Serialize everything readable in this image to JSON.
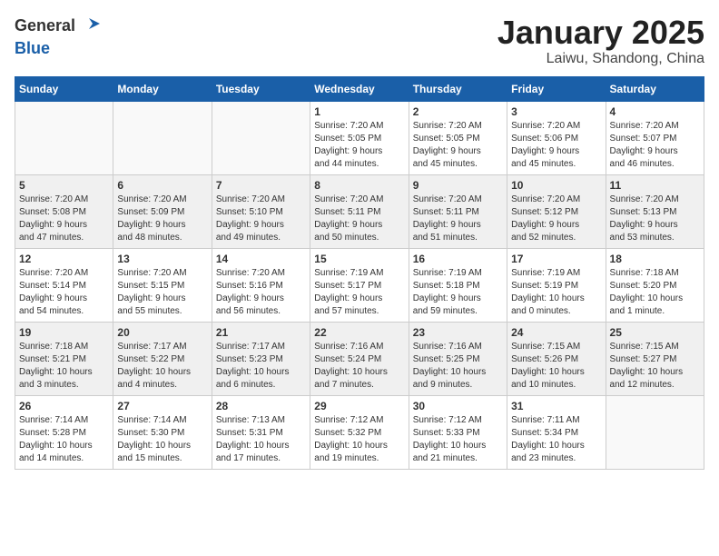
{
  "header": {
    "logo": {
      "general": "General",
      "blue": "Blue"
    },
    "title": "January 2025",
    "subtitle": "Laiwu, Shandong, China"
  },
  "weekdays": [
    "Sunday",
    "Monday",
    "Tuesday",
    "Wednesday",
    "Thursday",
    "Friday",
    "Saturday"
  ],
  "weeks": [
    {
      "shaded": false,
      "days": [
        {
          "num": "",
          "info": ""
        },
        {
          "num": "",
          "info": ""
        },
        {
          "num": "",
          "info": ""
        },
        {
          "num": "1",
          "info": "Sunrise: 7:20 AM\nSunset: 5:05 PM\nDaylight: 9 hours\nand 44 minutes."
        },
        {
          "num": "2",
          "info": "Sunrise: 7:20 AM\nSunset: 5:05 PM\nDaylight: 9 hours\nand 45 minutes."
        },
        {
          "num": "3",
          "info": "Sunrise: 7:20 AM\nSunset: 5:06 PM\nDaylight: 9 hours\nand 45 minutes."
        },
        {
          "num": "4",
          "info": "Sunrise: 7:20 AM\nSunset: 5:07 PM\nDaylight: 9 hours\nand 46 minutes."
        }
      ]
    },
    {
      "shaded": true,
      "days": [
        {
          "num": "5",
          "info": "Sunrise: 7:20 AM\nSunset: 5:08 PM\nDaylight: 9 hours\nand 47 minutes."
        },
        {
          "num": "6",
          "info": "Sunrise: 7:20 AM\nSunset: 5:09 PM\nDaylight: 9 hours\nand 48 minutes."
        },
        {
          "num": "7",
          "info": "Sunrise: 7:20 AM\nSunset: 5:10 PM\nDaylight: 9 hours\nand 49 minutes."
        },
        {
          "num": "8",
          "info": "Sunrise: 7:20 AM\nSunset: 5:11 PM\nDaylight: 9 hours\nand 50 minutes."
        },
        {
          "num": "9",
          "info": "Sunrise: 7:20 AM\nSunset: 5:11 PM\nDaylight: 9 hours\nand 51 minutes."
        },
        {
          "num": "10",
          "info": "Sunrise: 7:20 AM\nSunset: 5:12 PM\nDaylight: 9 hours\nand 52 minutes."
        },
        {
          "num": "11",
          "info": "Sunrise: 7:20 AM\nSunset: 5:13 PM\nDaylight: 9 hours\nand 53 minutes."
        }
      ]
    },
    {
      "shaded": false,
      "days": [
        {
          "num": "12",
          "info": "Sunrise: 7:20 AM\nSunset: 5:14 PM\nDaylight: 9 hours\nand 54 minutes."
        },
        {
          "num": "13",
          "info": "Sunrise: 7:20 AM\nSunset: 5:15 PM\nDaylight: 9 hours\nand 55 minutes."
        },
        {
          "num": "14",
          "info": "Sunrise: 7:20 AM\nSunset: 5:16 PM\nDaylight: 9 hours\nand 56 minutes."
        },
        {
          "num": "15",
          "info": "Sunrise: 7:19 AM\nSunset: 5:17 PM\nDaylight: 9 hours\nand 57 minutes."
        },
        {
          "num": "16",
          "info": "Sunrise: 7:19 AM\nSunset: 5:18 PM\nDaylight: 9 hours\nand 59 minutes."
        },
        {
          "num": "17",
          "info": "Sunrise: 7:19 AM\nSunset: 5:19 PM\nDaylight: 10 hours\nand 0 minutes."
        },
        {
          "num": "18",
          "info": "Sunrise: 7:18 AM\nSunset: 5:20 PM\nDaylight: 10 hours\nand 1 minute."
        }
      ]
    },
    {
      "shaded": true,
      "days": [
        {
          "num": "19",
          "info": "Sunrise: 7:18 AM\nSunset: 5:21 PM\nDaylight: 10 hours\nand 3 minutes."
        },
        {
          "num": "20",
          "info": "Sunrise: 7:17 AM\nSunset: 5:22 PM\nDaylight: 10 hours\nand 4 minutes."
        },
        {
          "num": "21",
          "info": "Sunrise: 7:17 AM\nSunset: 5:23 PM\nDaylight: 10 hours\nand 6 minutes."
        },
        {
          "num": "22",
          "info": "Sunrise: 7:16 AM\nSunset: 5:24 PM\nDaylight: 10 hours\nand 7 minutes."
        },
        {
          "num": "23",
          "info": "Sunrise: 7:16 AM\nSunset: 5:25 PM\nDaylight: 10 hours\nand 9 minutes."
        },
        {
          "num": "24",
          "info": "Sunrise: 7:15 AM\nSunset: 5:26 PM\nDaylight: 10 hours\nand 10 minutes."
        },
        {
          "num": "25",
          "info": "Sunrise: 7:15 AM\nSunset: 5:27 PM\nDaylight: 10 hours\nand 12 minutes."
        }
      ]
    },
    {
      "shaded": false,
      "days": [
        {
          "num": "26",
          "info": "Sunrise: 7:14 AM\nSunset: 5:28 PM\nDaylight: 10 hours\nand 14 minutes."
        },
        {
          "num": "27",
          "info": "Sunrise: 7:14 AM\nSunset: 5:30 PM\nDaylight: 10 hours\nand 15 minutes."
        },
        {
          "num": "28",
          "info": "Sunrise: 7:13 AM\nSunset: 5:31 PM\nDaylight: 10 hours\nand 17 minutes."
        },
        {
          "num": "29",
          "info": "Sunrise: 7:12 AM\nSunset: 5:32 PM\nDaylight: 10 hours\nand 19 minutes."
        },
        {
          "num": "30",
          "info": "Sunrise: 7:12 AM\nSunset: 5:33 PM\nDaylight: 10 hours\nand 21 minutes."
        },
        {
          "num": "31",
          "info": "Sunrise: 7:11 AM\nSunset: 5:34 PM\nDaylight: 10 hours\nand 23 minutes."
        },
        {
          "num": "",
          "info": ""
        }
      ]
    }
  ]
}
